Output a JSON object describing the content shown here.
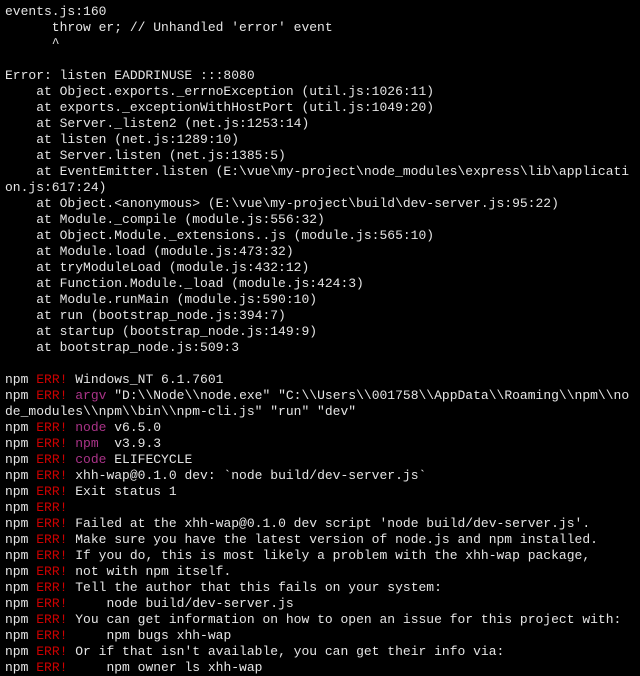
{
  "lines": [
    {
      "text": "events.js:160",
      "cls": "white"
    },
    {
      "text": "      throw er; // Unhandled 'error' event",
      "cls": "white"
    },
    {
      "text": "      ^",
      "cls": "white"
    },
    {
      "text": "",
      "cls": "white"
    },
    {
      "text": "Error: listen EADDRINUSE :::8080",
      "cls": "white"
    },
    {
      "text": "    at Object.exports._errnoException (util.js:1026:11)",
      "cls": "white"
    },
    {
      "text": "    at exports._exceptionWithHostPort (util.js:1049:20)",
      "cls": "white"
    },
    {
      "text": "    at Server._listen2 (net.js:1253:14)",
      "cls": "white"
    },
    {
      "text": "    at listen (net.js:1289:10)",
      "cls": "white"
    },
    {
      "text": "    at Server.listen (net.js:1385:5)",
      "cls": "white"
    },
    {
      "text": "    at EventEmitter.listen (E:\\vue\\my-project\\node_modules\\express\\lib\\applicati",
      "cls": "white"
    },
    {
      "text": "on.js:617:24)",
      "cls": "white"
    },
    {
      "text": "    at Object.<anonymous> (E:\\vue\\my-project\\build\\dev-server.js:95:22)",
      "cls": "white"
    },
    {
      "text": "    at Module._compile (module.js:556:32)",
      "cls": "white"
    },
    {
      "text": "    at Object.Module._extensions..js (module.js:565:10)",
      "cls": "white"
    },
    {
      "text": "    at Module.load (module.js:473:32)",
      "cls": "white"
    },
    {
      "text": "    at tryModuleLoad (module.js:432:12)",
      "cls": "white"
    },
    {
      "text": "    at Function.Module._load (module.js:424:3)",
      "cls": "white"
    },
    {
      "text": "    at Module.runMain (module.js:590:10)",
      "cls": "white"
    },
    {
      "text": "    at run (bootstrap_node.js:394:7)",
      "cls": "white"
    },
    {
      "text": "    at startup (bootstrap_node.js:149:9)",
      "cls": "white"
    },
    {
      "text": "    at bootstrap_node.js:509:3",
      "cls": "white"
    },
    {
      "text": "",
      "cls": "white"
    }
  ],
  "npmLines": [
    {
      "parts": [
        {
          "t": "npm ",
          "c": "white"
        },
        {
          "t": "ERR! ",
          "c": "red"
        },
        {
          "t": "Windows_NT 6.1.7601",
          "c": "white"
        }
      ]
    },
    {
      "parts": [
        {
          "t": "npm ",
          "c": "white"
        },
        {
          "t": "ERR! ",
          "c": "red"
        },
        {
          "t": "argv",
          "c": "magenta"
        },
        {
          "t": " \"D:\\\\Node\\\\node.exe\" \"C:\\\\Users\\\\001758\\\\AppData\\\\Roaming\\\\npm\\\\no",
          "c": "white"
        }
      ]
    },
    {
      "parts": [
        {
          "t": "de_modules\\\\npm\\\\bin\\\\npm-cli.js\" \"run\" \"dev\"",
          "c": "white"
        }
      ]
    },
    {
      "parts": [
        {
          "t": "npm ",
          "c": "white"
        },
        {
          "t": "ERR! ",
          "c": "red"
        },
        {
          "t": "node",
          "c": "magenta"
        },
        {
          "t": " v6.5.0",
          "c": "white"
        }
      ]
    },
    {
      "parts": [
        {
          "t": "npm ",
          "c": "white"
        },
        {
          "t": "ERR! ",
          "c": "red"
        },
        {
          "t": "npm ",
          "c": "magenta"
        },
        {
          "t": " v3.9.3",
          "c": "white"
        }
      ]
    },
    {
      "parts": [
        {
          "t": "npm ",
          "c": "white"
        },
        {
          "t": "ERR! ",
          "c": "red"
        },
        {
          "t": "code",
          "c": "magenta"
        },
        {
          "t": " ELIFECYCLE",
          "c": "white"
        }
      ]
    },
    {
      "parts": [
        {
          "t": "npm ",
          "c": "white"
        },
        {
          "t": "ERR! ",
          "c": "red"
        },
        {
          "t": "xhh-wap@0.1.0 dev: `node build/dev-server.js`",
          "c": "white"
        }
      ]
    },
    {
      "parts": [
        {
          "t": "npm ",
          "c": "white"
        },
        {
          "t": "ERR! ",
          "c": "red"
        },
        {
          "t": "Exit status 1",
          "c": "white"
        }
      ]
    },
    {
      "parts": [
        {
          "t": "npm ",
          "c": "white"
        },
        {
          "t": "ERR!",
          "c": "red"
        }
      ]
    },
    {
      "parts": [
        {
          "t": "npm ",
          "c": "white"
        },
        {
          "t": "ERR! ",
          "c": "red"
        },
        {
          "t": "Failed at the xhh-wap@0.1.0 dev script 'node build/dev-server.js'.",
          "c": "white"
        }
      ]
    },
    {
      "parts": [
        {
          "t": "npm ",
          "c": "white"
        },
        {
          "t": "ERR! ",
          "c": "red"
        },
        {
          "t": "Make sure you have the latest version of node.js and npm installed.",
          "c": "white"
        }
      ]
    },
    {
      "parts": [
        {
          "t": "npm ",
          "c": "white"
        },
        {
          "t": "ERR! ",
          "c": "red"
        },
        {
          "t": "If you do, this is most likely a problem with the xhh-wap package,",
          "c": "white"
        }
      ]
    },
    {
      "parts": [
        {
          "t": "npm ",
          "c": "white"
        },
        {
          "t": "ERR! ",
          "c": "red"
        },
        {
          "t": "not with npm itself.",
          "c": "white"
        }
      ]
    },
    {
      "parts": [
        {
          "t": "npm ",
          "c": "white"
        },
        {
          "t": "ERR! ",
          "c": "red"
        },
        {
          "t": "Tell the author that this fails on your system:",
          "c": "white"
        }
      ]
    },
    {
      "parts": [
        {
          "t": "npm ",
          "c": "white"
        },
        {
          "t": "ERR! ",
          "c": "red"
        },
        {
          "t": "    node build/dev-server.js",
          "c": "white"
        }
      ]
    },
    {
      "parts": [
        {
          "t": "npm ",
          "c": "white"
        },
        {
          "t": "ERR! ",
          "c": "red"
        },
        {
          "t": "You can get information on how to open an issue for this project with:",
          "c": "white"
        }
      ]
    },
    {
      "parts": [
        {
          "t": "npm ",
          "c": "white"
        },
        {
          "t": "ERR! ",
          "c": "red"
        },
        {
          "t": "    npm bugs xhh-wap",
          "c": "white"
        }
      ]
    },
    {
      "parts": [
        {
          "t": "npm ",
          "c": "white"
        },
        {
          "t": "ERR! ",
          "c": "red"
        },
        {
          "t": "Or if that isn't available, you can get their info via:",
          "c": "white"
        }
      ]
    },
    {
      "parts": [
        {
          "t": "npm ",
          "c": "white"
        },
        {
          "t": "ERR! ",
          "c": "red"
        },
        {
          "t": "    npm owner ls xhh-wap",
          "c": "white"
        }
      ]
    }
  ]
}
